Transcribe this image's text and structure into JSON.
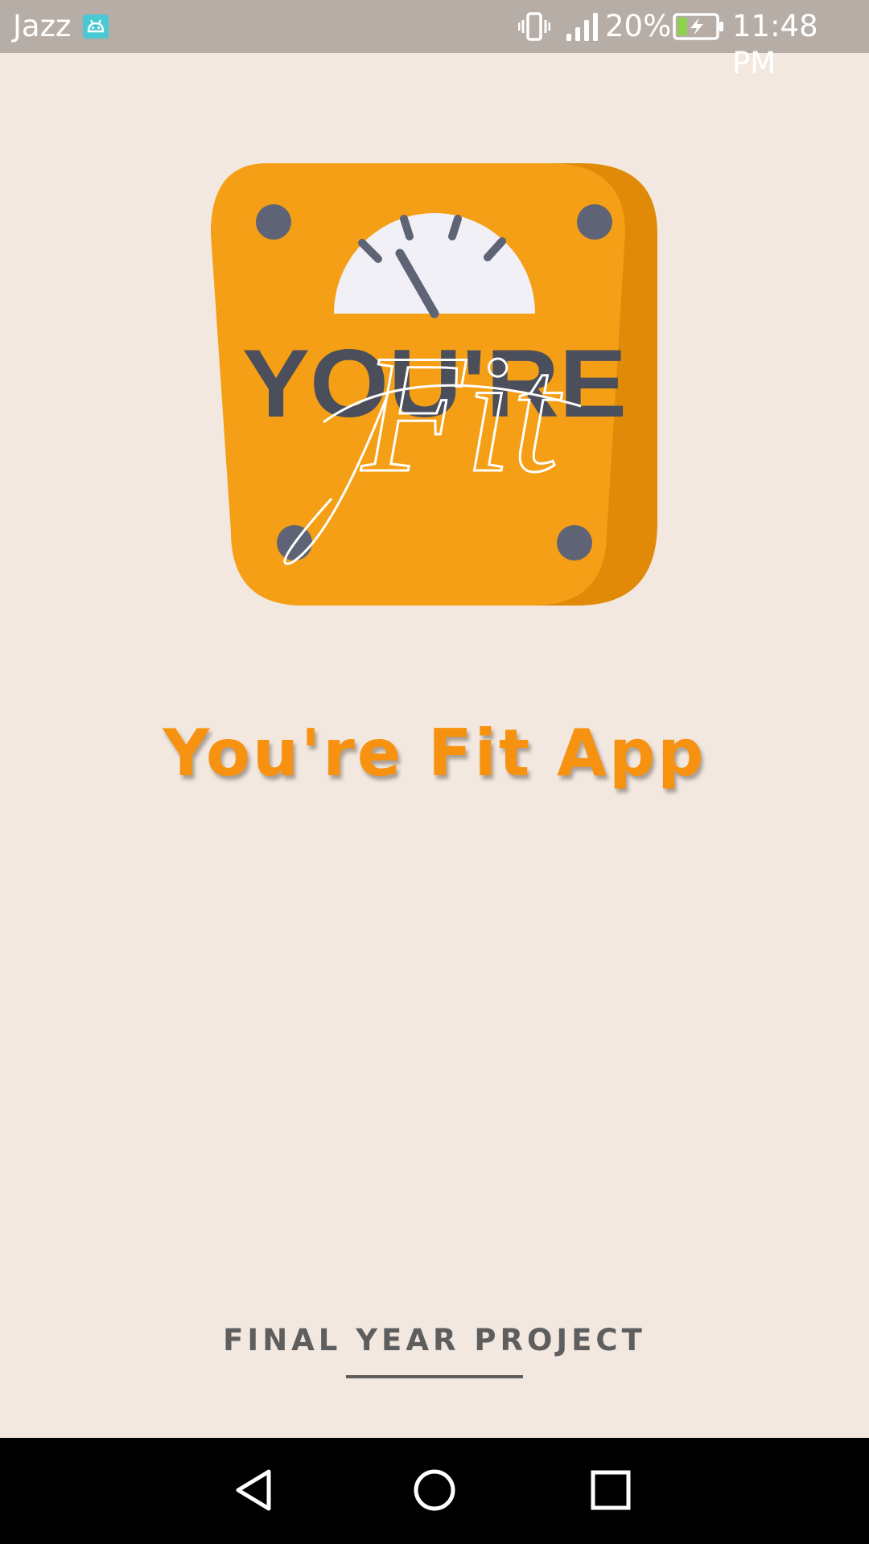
{
  "status_bar": {
    "carrier": "Jazz",
    "battery_percent": "20%",
    "time": "11:48 PM",
    "icons": [
      "android-icon",
      "vibrate-icon",
      "signal-icon",
      "battery-charging-icon"
    ]
  },
  "logo": {
    "wordmark": "YOU'RE",
    "script": "Fit",
    "colors": {
      "orange": "#f59f16",
      "dark_orange": "#e08a08",
      "slate": "#4b4e5b",
      "dot": "#5e6376",
      "dial": "#f0f0f6"
    }
  },
  "app_title": "You're Fit App",
  "footer": {
    "text": "FINAL YEAR PROJECT"
  },
  "nav_bar": {
    "buttons": [
      "back-icon",
      "home-icon",
      "recents-icon"
    ]
  },
  "colors": {
    "background": "#f3e8df",
    "status_bar": "#b6ada6",
    "accent": "#f6920f",
    "footer_text": "#5f5e5e"
  }
}
